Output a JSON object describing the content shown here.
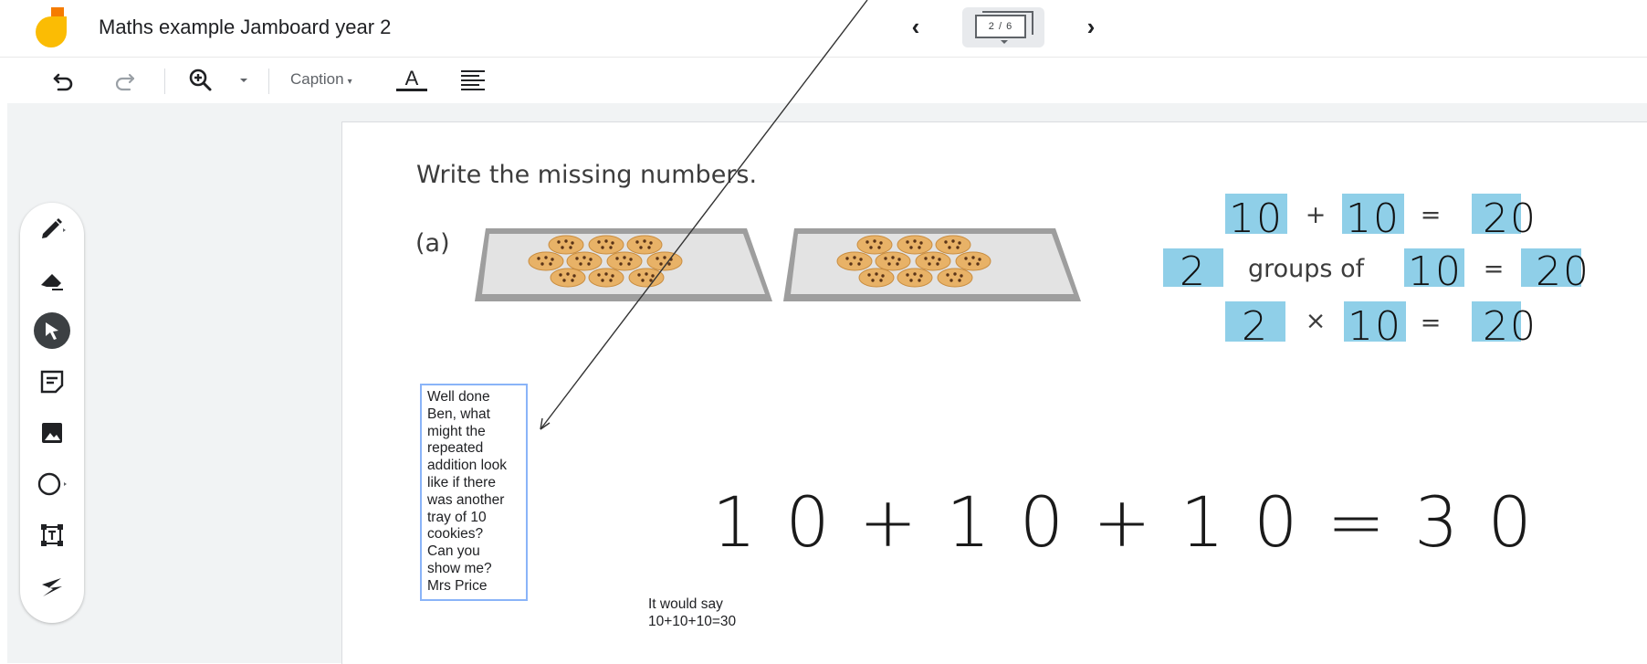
{
  "header": {
    "title": "Maths example Jamboard year 2",
    "frame_counter": "2 / 6"
  },
  "toolbar": {
    "caption_label": "Caption"
  },
  "tools": [
    "pen",
    "eraser",
    "select",
    "sticky-note",
    "add-image",
    "circle",
    "text-box",
    "laser"
  ],
  "board": {
    "prompt": "Write the missing numbers.",
    "part_label": "(a)",
    "tray_count": 2,
    "cookies_per_tray": 10,
    "equations": {
      "row1_a": "10",
      "row1_b": "10",
      "row1_answer": "20",
      "row2_a": "2",
      "row2_groups_text": "groups of",
      "row2_b": "10",
      "row2_answer": "20",
      "row3_a": "2",
      "row3_b": "10",
      "row3_answer": "20"
    },
    "handwritten_equation": "10+10+10=30",
    "teacher_comment": [
      "Well done",
      "Ben, what",
      "might the",
      "repeated",
      "addition look",
      "like if there",
      "was another",
      "tray of 10",
      "cookies?",
      "Can you",
      "show me?",
      "Mrs Price"
    ],
    "pupil_reply": [
      "It would say",
      "10+10+10=30"
    ]
  },
  "colors": {
    "accent_blue": "#8fcfe8",
    "comment_border": "#8ab4f8",
    "logo_yellow": "#fbbc04",
    "logo_orange": "#f57c00"
  }
}
